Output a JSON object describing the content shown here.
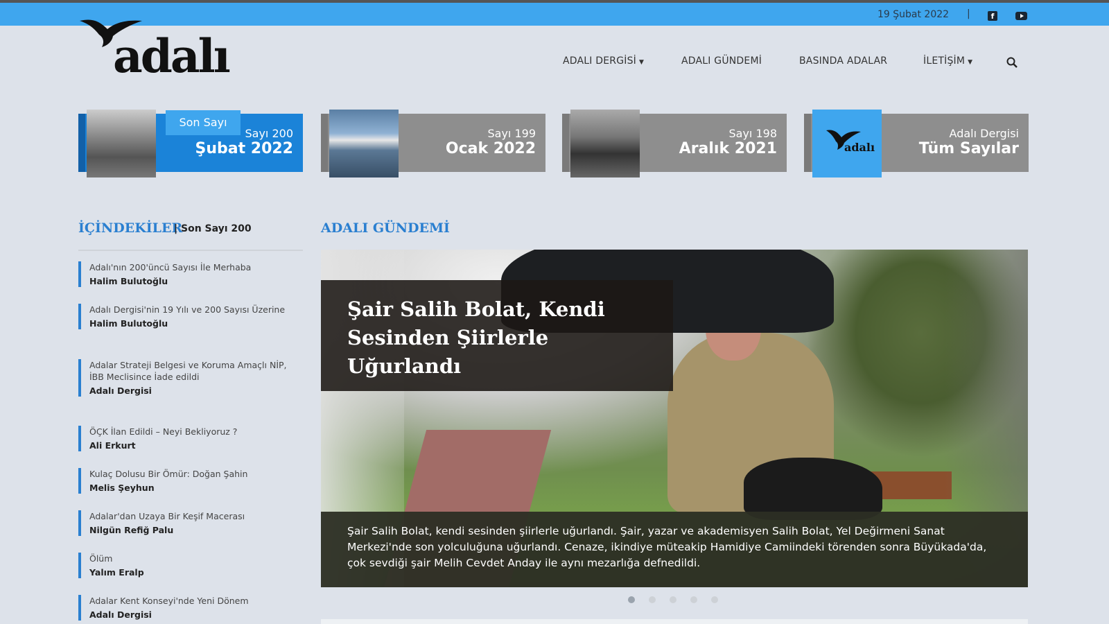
{
  "topbar": {
    "date": "19 Şubat 2022",
    "separator": "|",
    "social": [
      "facebook-icon",
      "youtube-icon"
    ],
    "color": "#3fa6ee"
  },
  "logo": {
    "text": "adalı"
  },
  "nav": {
    "items": [
      {
        "label": "ADALI DERGİSİ",
        "dropdown": true
      },
      {
        "label": "ADALI GÜNDEMİ",
        "dropdown": false
      },
      {
        "label": "BASINDA ADALAR",
        "dropdown": false
      },
      {
        "label": "İLETİŞİM",
        "dropdown": true
      }
    ],
    "chevron": "⌄"
  },
  "issues": [
    {
      "badge": "Son Sayı",
      "number": "Sayı 200",
      "month": "Şubat 2022",
      "active": true
    },
    {
      "number": "Sayı 199",
      "month": "Ocak 2022"
    },
    {
      "number": "Sayı 198",
      "month": "Aralık 2021"
    },
    {
      "number": "Adalı Dergisi",
      "month": "Tüm Sayılar"
    }
  ],
  "toc": {
    "title": "İÇİNDEKİLER",
    "subtitle": "| Son Sayı 200",
    "items": [
      {
        "title": "Adalı'nın 200'üncü Sayısı İle Merhaba",
        "author": "Halim Bulutoğlu"
      },
      {
        "title": "Adalı Dergisi'nin 19 Yılı ve 200 Sayısı Üzerine",
        "author": "Halim Bulutoğlu"
      },
      {
        "title": "Adalar Strateji Belgesi ve Koruma Amaçlı NİP, İBB Meclisince İade edildi",
        "author": "Adalı Dergisi"
      },
      {
        "title": "ÖÇK İlan Edildi – Neyi Bekliyoruz ?",
        "author": "Ali Erkurt"
      },
      {
        "title": "Kulaç Dolusu Bir Ömür: Doğan Şahin",
        "author": "Melis Şeyhun"
      },
      {
        "title": "Adalar'dan Uzaya Bir Keşif Macerası",
        "author": "Nilgün Refiğ Palu"
      },
      {
        "title": "Ölüm",
        "author": "Yalım Eralp"
      },
      {
        "title": "Adalar Kent Konseyi'nde Yeni Dönem",
        "author": "Adalı Dergisi"
      }
    ]
  },
  "gundem": {
    "title": "ADALI GÜNDEMİ",
    "headline": "Şair Salih Bolat, Kendi Sesinden Şiirlerle Uğurlandı",
    "caption": "Şair Salih Bolat, kendi sesinden şiirlerle uğurlandı. Şair, yazar ve akademisyen Salih Bolat, Yel Değirmeni Sanat Merkezi'nde son yolculuğuna uğurlandı. Cenaze, ikindiye müteakip Hamidiye Camiindeki törenden sonra Büyükada'da, çok sevdiği şair Melih Cevdet Anday ile aynı mezarlığa defnedildi.",
    "slides": 5,
    "active_slide": 1
  }
}
